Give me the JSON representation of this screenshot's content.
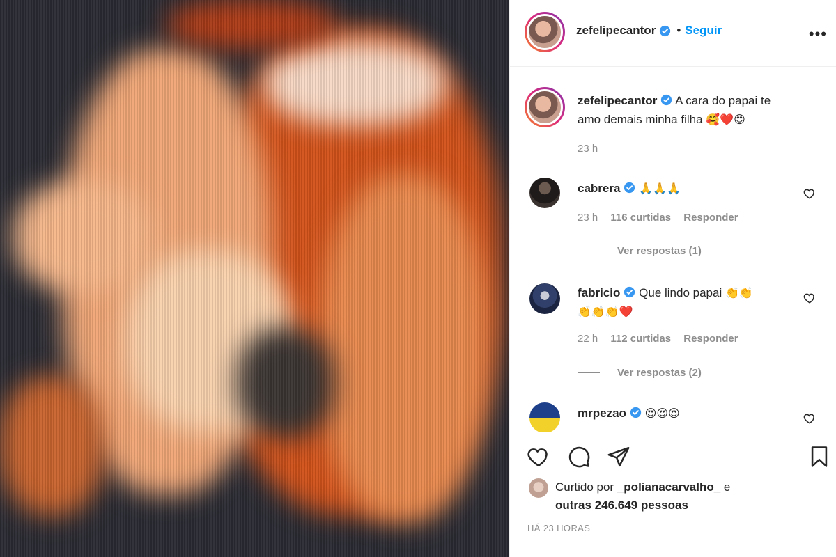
{
  "post": {
    "author": "zefelipecantor",
    "follow_label": "Seguir",
    "separator": "•",
    "more_label": "•••"
  },
  "caption": {
    "username": "zefelipecantor",
    "text_line1": "A cara do papai te",
    "text_line2": "amo demais minha filha",
    "emojis": "🥰❤️😍",
    "time": "23 h"
  },
  "comments": [
    {
      "username": "cabrera",
      "text": "",
      "emojis": "🙏🙏🙏",
      "time": "23 h",
      "likes": "116 curtidas",
      "reply_label": "Responder",
      "view_replies": "Ver respostas (1)"
    },
    {
      "username": "fabricio",
      "text": "Que lindo papai",
      "emojis_line1": "👏👏",
      "emojis_line2": "👏👏👏❤️",
      "time": "22 h",
      "likes": "112 curtidas",
      "reply_label": "Responder",
      "view_replies": "Ver respostas (2)"
    },
    {
      "username": "mrpezao",
      "emojis": "😍😍😍"
    }
  ],
  "likes_summary": {
    "prefix": "Curtido por",
    "user": "_polianacarvalho_",
    "connector": "e",
    "others": "outras 246.649 pessoas"
  },
  "posted_ago": "HÁ 23 HORAS",
  "icons": [
    "heart-icon",
    "comment-icon",
    "share-icon",
    "bookmark-icon",
    "verified-badge-icon",
    "more-options-icon"
  ],
  "colors": {
    "link_blue": "#0095f6",
    "verified_blue": "#3897f0",
    "muted": "#8e8e8e",
    "text": "#262626"
  }
}
